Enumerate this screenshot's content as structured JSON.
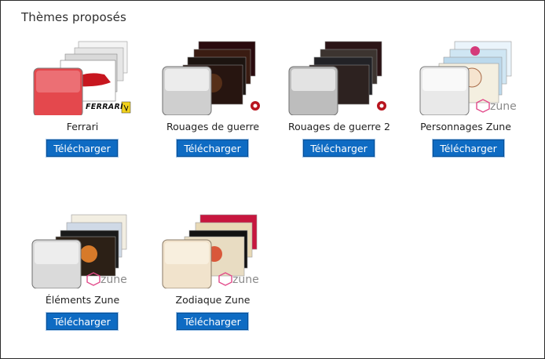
{
  "section": {
    "title": "Thèmes proposés"
  },
  "themes": [
    {
      "name": "Ferrari",
      "button_label": "Télécharger",
      "badge": "FERRARI"
    },
    {
      "name": "Rouages de guerre",
      "button_label": "Télécharger"
    },
    {
      "name": "Rouages de guerre 2",
      "button_label": "Télécharger"
    },
    {
      "name": "Personnages Zune",
      "button_label": "Télécharger",
      "badge": "zune"
    },
    {
      "name": "Éléments Zune",
      "button_label": "Télécharger",
      "badge": "zune"
    },
    {
      "name": "Zodiaque Zune",
      "button_label": "Télécharger",
      "badge": "zune"
    }
  ],
  "colors": {
    "button_bg": "#0e6bc3",
    "ferrari_red": "#d6232e",
    "gears_red": "#b8141e",
    "zune_gray": "#8a8a8a",
    "zune_pink": "#e24a8a"
  }
}
